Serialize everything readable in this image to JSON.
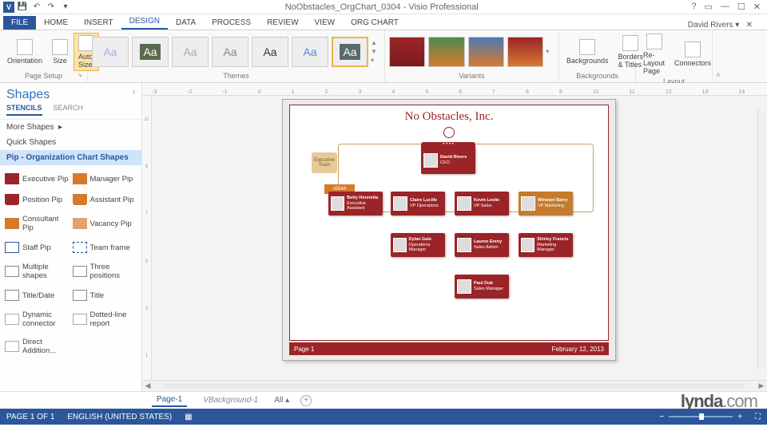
{
  "app": {
    "product": "Visio Professional",
    "filename": "NoObstacles_OrgChart_0304",
    "user": "David Rivers"
  },
  "qat": {
    "items": [
      "save",
      "undo",
      "redo",
      "touch"
    ]
  },
  "window_controls": [
    "help",
    "restore-up",
    "minimize",
    "maximize",
    "close"
  ],
  "tabs": {
    "items": [
      "FILE",
      "HOME",
      "INSERT",
      "DESIGN",
      "DATA",
      "PROCESS",
      "REVIEW",
      "VIEW",
      "ORG CHART"
    ],
    "active": "DESIGN"
  },
  "ribbon": {
    "page_setup": {
      "label": "Page Setup",
      "orientation": "Orientation",
      "size": "Size",
      "auto_size": "Auto Size"
    },
    "themes": {
      "label": "Themes"
    },
    "variants": {
      "label": "Variants"
    },
    "backgrounds": {
      "label": "Backgrounds",
      "backgrounds_btn": "Backgrounds",
      "borders_btn": "Borders & Titles"
    },
    "layout": {
      "label": "Layout",
      "relayout": "Re-Layout Page",
      "connectors": "Connectors"
    }
  },
  "shapes_panel": {
    "title": "Shapes",
    "tabs": [
      "STENCILS",
      "SEARCH"
    ],
    "active_tab": "STENCILS",
    "sections": {
      "more": "More Shapes",
      "quick": "Quick Shapes",
      "current": "Pip - Organization Chart Shapes"
    },
    "items": [
      {
        "label": "Executive Pip",
        "cls": "pip-exec"
      },
      {
        "label": "Manager Pip",
        "cls": "pip-mgr"
      },
      {
        "label": "Position Pip",
        "cls": "pip-pos"
      },
      {
        "label": "Assistant Pip",
        "cls": "pip-asst"
      },
      {
        "label": "Consultant Pip",
        "cls": "pip-cons"
      },
      {
        "label": "Vacancy Pip",
        "cls": "pip-vac"
      },
      {
        "label": "Staff Pip",
        "cls": "pip-staff"
      },
      {
        "label": "Team frame",
        "cls": "pip-frame"
      },
      {
        "label": "Multiple shapes",
        "cls": "pip-mult"
      },
      {
        "label": "Three positions",
        "cls": "pip-three"
      },
      {
        "label": "Title/Date",
        "cls": "pip-xyz"
      },
      {
        "label": "Title",
        "cls": "pip-xyz"
      },
      {
        "label": "Dynamic connector",
        "cls": "pip-conn"
      },
      {
        "label": "Dotted-line report",
        "cls": "pip-conn"
      },
      {
        "label": "Direct Addition...",
        "cls": "pip-conn"
      }
    ]
  },
  "org_chart": {
    "company": "No Obstacles, Inc.",
    "team_frame": "Executive Team",
    "synergy": "x5544",
    "page_label": "Page 1",
    "date": "February 12, 2013",
    "ceo": {
      "name": "David Rivers",
      "title": "CEO"
    },
    "asst": {
      "name": "Betty Henrietta",
      "title": "Executive Assistant"
    },
    "vps": [
      {
        "name": "Claire Lucille",
        "title": "VP Operations"
      },
      {
        "name": "Kevin Leslie",
        "title": "VP Sales"
      },
      {
        "name": "Winston Barry",
        "title": "VP Marketing",
        "cls": "mgr"
      }
    ],
    "mgrs": [
      {
        "name": "Dylan Gale",
        "title": "Operations Manager"
      },
      {
        "name": "Lauren Ereny",
        "title": "Sales Admin"
      },
      {
        "name": "Shirley Francis",
        "title": "Marketing Manager"
      }
    ],
    "staff": [
      {
        "name": "Paul Dub",
        "title": "Sales Manager"
      }
    ]
  },
  "ruler_h": [
    "-3",
    "-2",
    "-1",
    "0",
    "1",
    "2",
    "3",
    "4",
    "5",
    "6",
    "7",
    "8",
    "9",
    "10",
    "11",
    "12",
    "13",
    "14"
  ],
  "ruler_v": [
    "11",
    "9",
    "7",
    "5",
    "3",
    "1"
  ],
  "page_tabs": {
    "page1": "Page-1",
    "vbg": "VBackground-1",
    "all": "All"
  },
  "status": {
    "page": "PAGE 1 OF 1",
    "lang": "ENGLISH (UNITED STATES)"
  },
  "watermark": {
    "brand": "lynda",
    "suffix": ".com"
  }
}
